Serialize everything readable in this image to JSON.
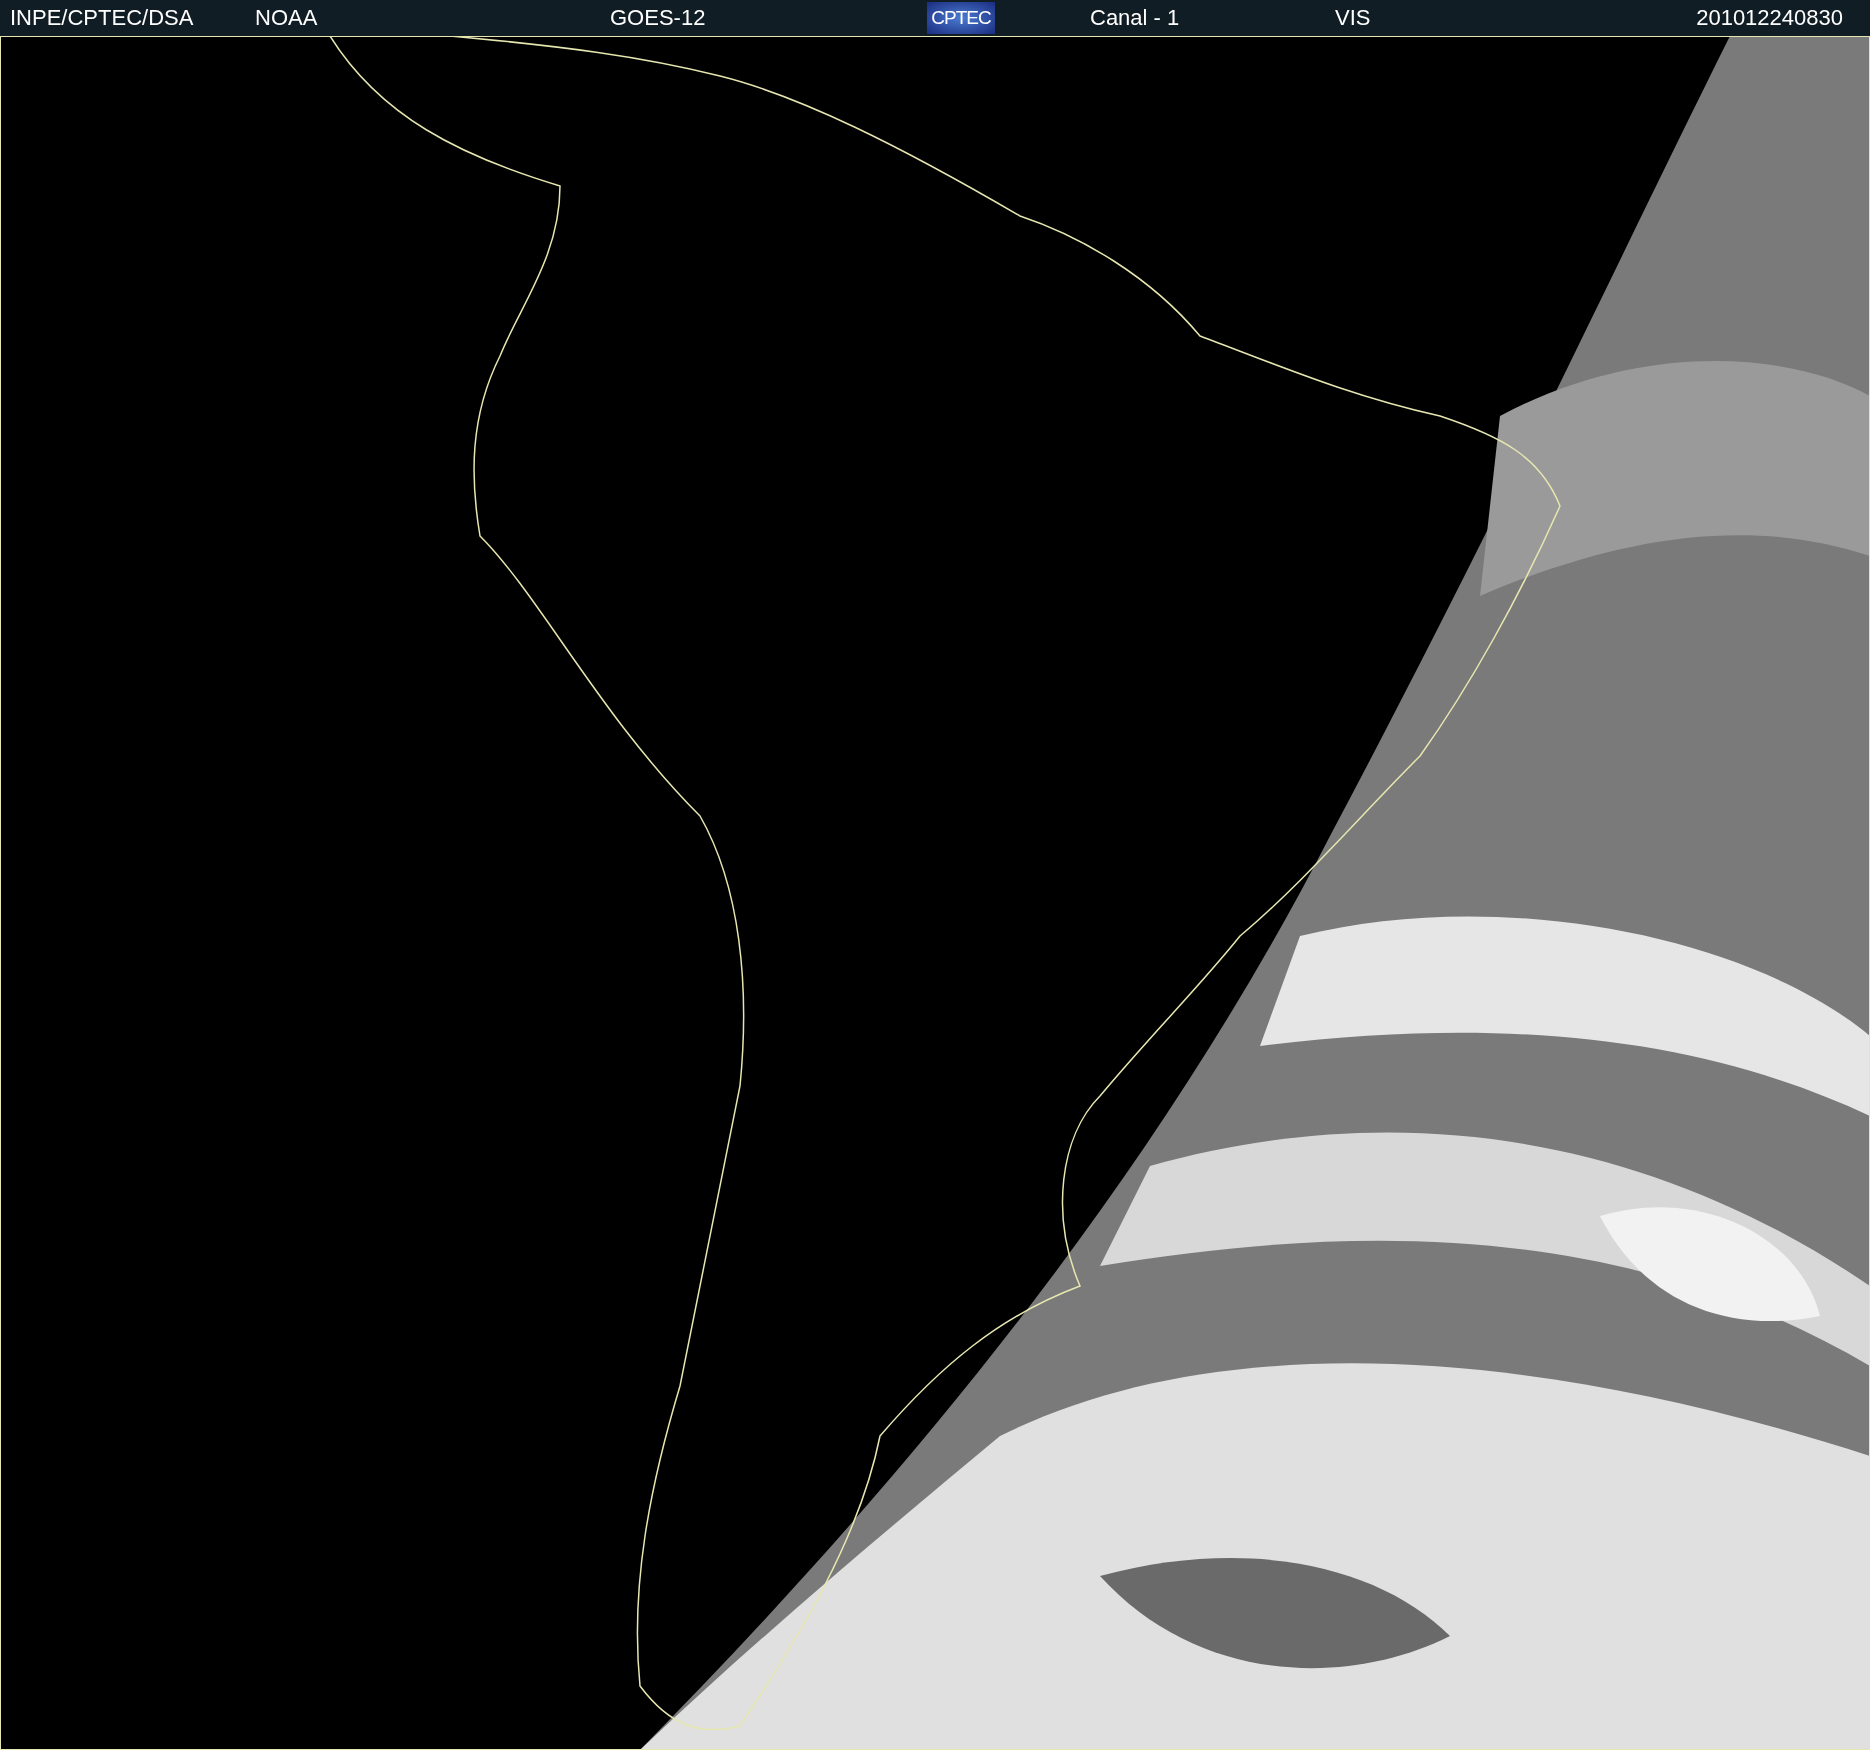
{
  "header": {
    "items": [
      {
        "kind": "text",
        "text": "INPE/CPTEC/DSA"
      },
      {
        "kind": "text",
        "text": "NOAA"
      },
      {
        "kind": "text",
        "text": "GOES-12"
      },
      {
        "kind": "logo",
        "text": "CPTEC"
      },
      {
        "kind": "text",
        "text": "Canal - 1"
      },
      {
        "kind": "text",
        "text": "VIS"
      },
      {
        "kind": "text",
        "text": "201012240830"
      }
    ]
  }
}
